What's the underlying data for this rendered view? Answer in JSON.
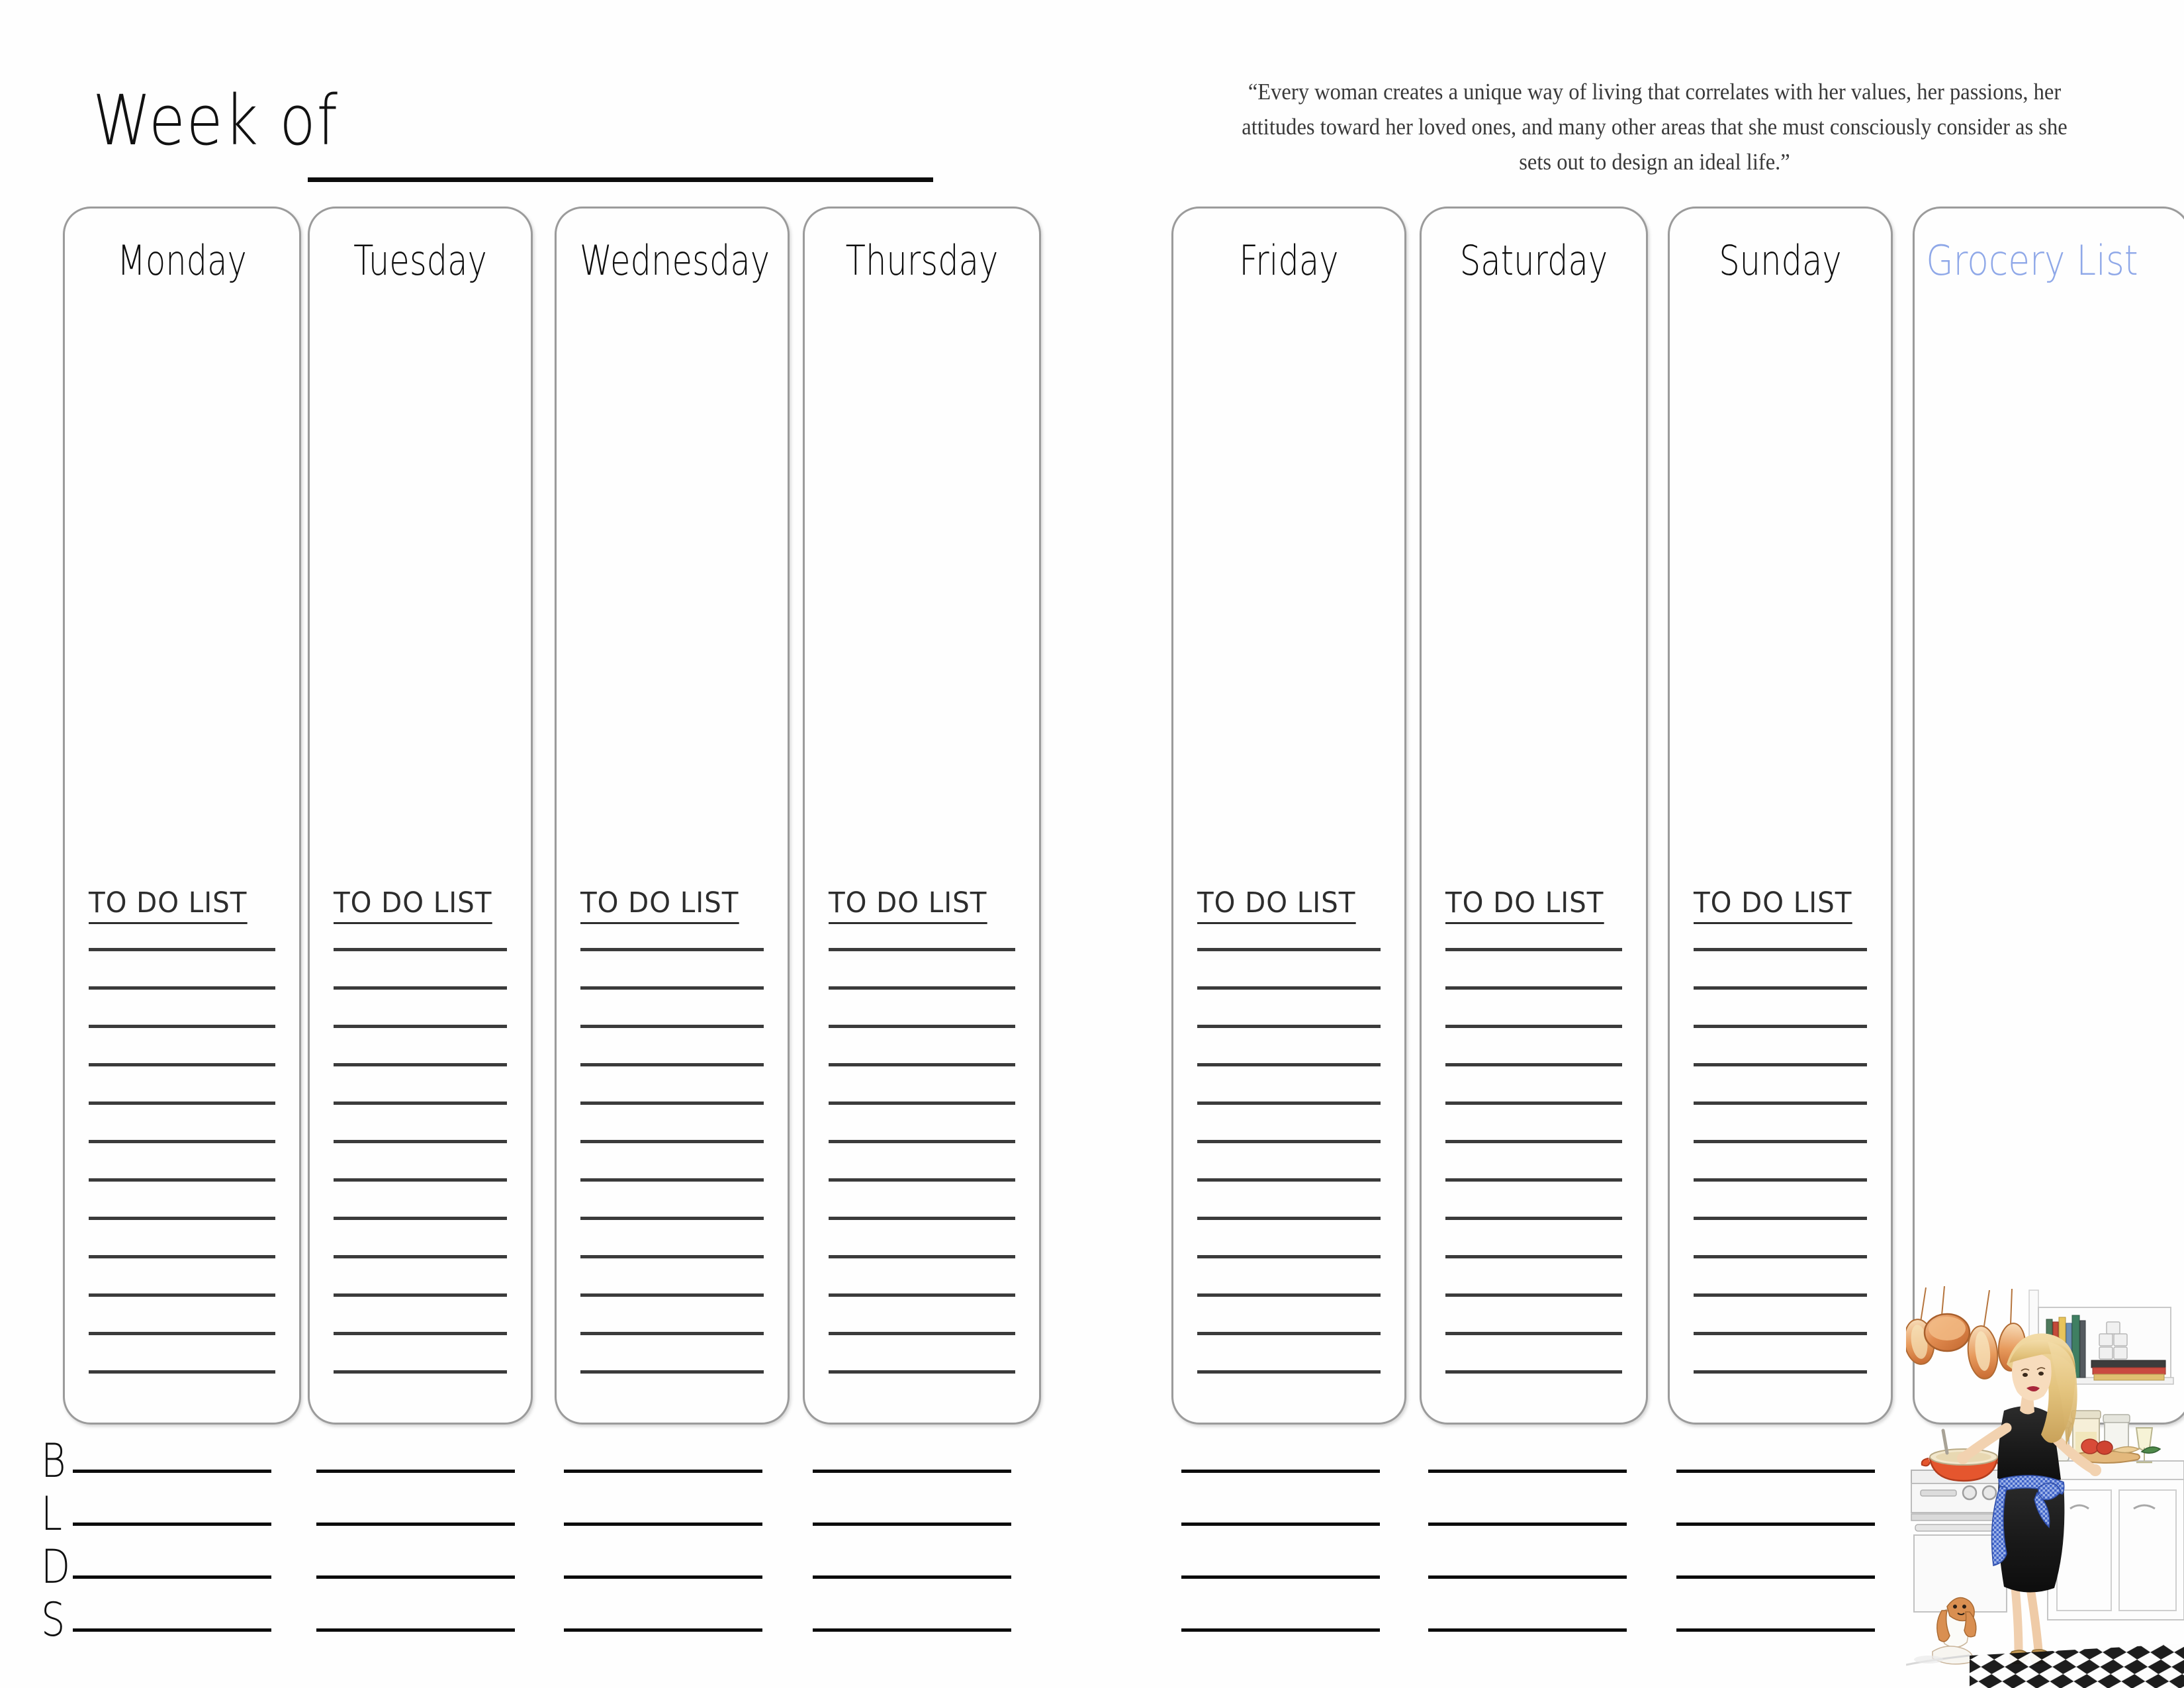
{
  "header": {
    "week_of_label": "Week of",
    "quote": "“Every woman creates a unique way of living that correlates with her values, her passions, her attitudes toward her loved ones, and many other areas that she must consciously consider as she sets out to design an ideal life.”"
  },
  "colors": {
    "card_border": "#9b9b9b",
    "grocery_accent": "#8fa8e8",
    "ink": "#0d0d0d",
    "rule": "#3b3b3b"
  },
  "columns": [
    {
      "id": "monday",
      "label": "Monday",
      "todo_label": "TO DO LIST",
      "todo_line_count": 12,
      "has_todo": true,
      "has_meals": true,
      "accent": false
    },
    {
      "id": "tuesday",
      "label": "Tuesday",
      "todo_label": "TO DO LIST",
      "todo_line_count": 12,
      "has_todo": true,
      "has_meals": true,
      "accent": false
    },
    {
      "id": "wednesday",
      "label": "Wednesday",
      "todo_label": "TO DO LIST",
      "todo_line_count": 12,
      "has_todo": true,
      "has_meals": true,
      "accent": false
    },
    {
      "id": "thursday",
      "label": "Thursday",
      "todo_label": "TO DO LIST",
      "todo_line_count": 12,
      "has_todo": true,
      "has_meals": true,
      "accent": false
    },
    {
      "id": "friday",
      "label": "Friday",
      "todo_label": "TO DO LIST",
      "todo_line_count": 12,
      "has_todo": true,
      "has_meals": true,
      "accent": false
    },
    {
      "id": "saturday",
      "label": "Saturday",
      "todo_label": "TO DO LIST",
      "todo_line_count": 12,
      "has_todo": true,
      "has_meals": true,
      "accent": false
    },
    {
      "id": "sunday",
      "label": "Sunday",
      "todo_label": "TO DO LIST",
      "todo_line_count": 12,
      "has_todo": true,
      "has_meals": true,
      "accent": false
    },
    {
      "id": "grocerylist",
      "label": "Grocery List",
      "todo_label": "",
      "todo_line_count": 0,
      "has_todo": false,
      "has_meals": false,
      "accent": true
    }
  ],
  "meals": {
    "rows": [
      {
        "id": "breakfast",
        "letter": "B"
      },
      {
        "id": "lunch",
        "letter": "L"
      },
      {
        "id": "dinner",
        "letter": "D"
      },
      {
        "id": "snack",
        "letter": "S"
      }
    ],
    "lines_per_row": 7
  },
  "illustration": {
    "name": "woman-cooking-in-kitchen-illustration",
    "description": "Watercolor illustration of a blonde woman in a black dress and blue gingham apron cooking at a stove, with copper pans hanging above, a shelf of books and jars, a spaniel dog, and a checkered floor."
  }
}
